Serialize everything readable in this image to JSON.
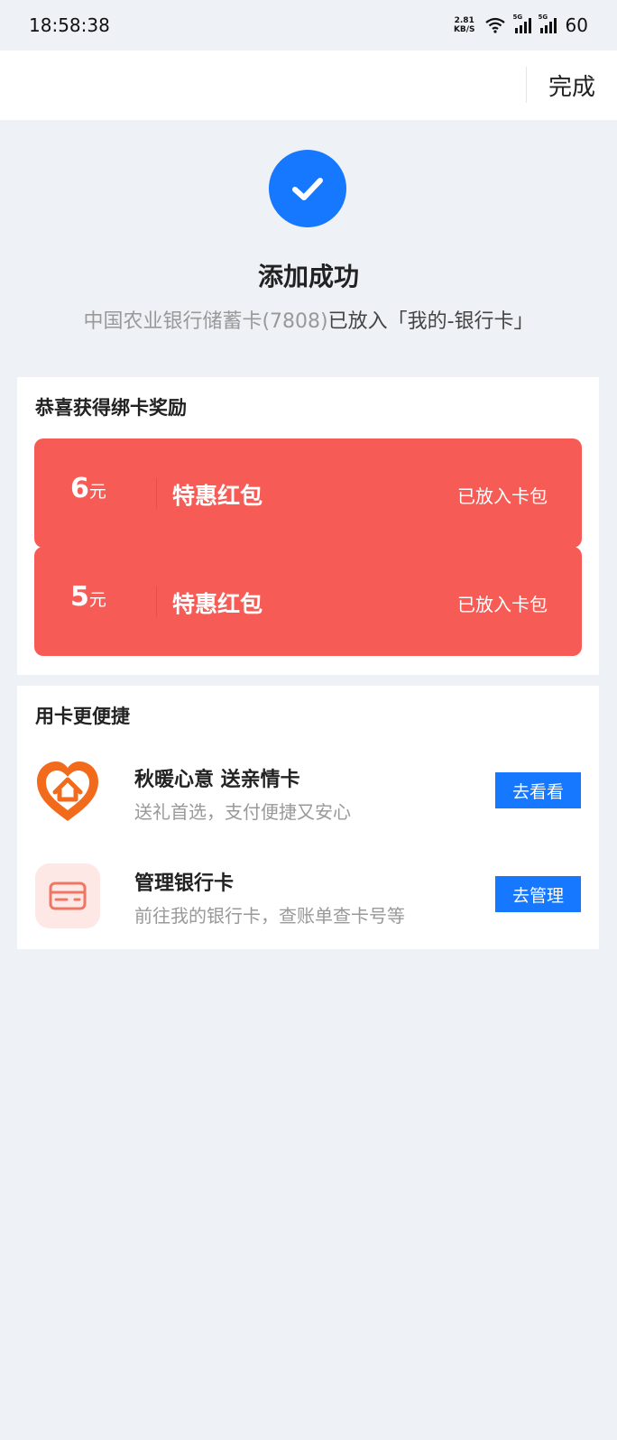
{
  "status_bar": {
    "time": "18:58:38",
    "net_speed_value": "2.81",
    "net_speed_unit": "KB/S",
    "battery": "60",
    "icons": [
      "wifi-icon",
      "signal-5g-icon",
      "signal-5g-icon"
    ]
  },
  "header": {
    "done_label": "完成"
  },
  "success": {
    "icon": "check-circle-icon",
    "title": "添加成功",
    "desc_prefix": "中国农业银行储蓄卡(7808)",
    "desc_suffix": "已放入「我的-银行卡」"
  },
  "rewards": {
    "title": "恭喜获得绑卡奖励",
    "items": [
      {
        "amount": "6",
        "unit": "元",
        "name": "特惠红包",
        "status": "已放入卡包"
      },
      {
        "amount": "5",
        "unit": "元",
        "name": "特惠红包",
        "status": "已放入卡包"
      }
    ]
  },
  "convenience": {
    "title": "用卡更便捷",
    "items": [
      {
        "icon": "heart-home-icon",
        "title": "秋暖心意 送亲情卡",
        "subtitle": "送礼首选，支付便捷又安心",
        "button": "去看看"
      },
      {
        "icon": "bank-card-icon",
        "title": "管理银行卡",
        "subtitle": "前往我的银行卡，查账单查卡号等",
        "button": "去管理"
      }
    ]
  },
  "colors": {
    "accent": "#1677ff",
    "redpacket": "#f75b55",
    "background": "#eef1f6"
  }
}
